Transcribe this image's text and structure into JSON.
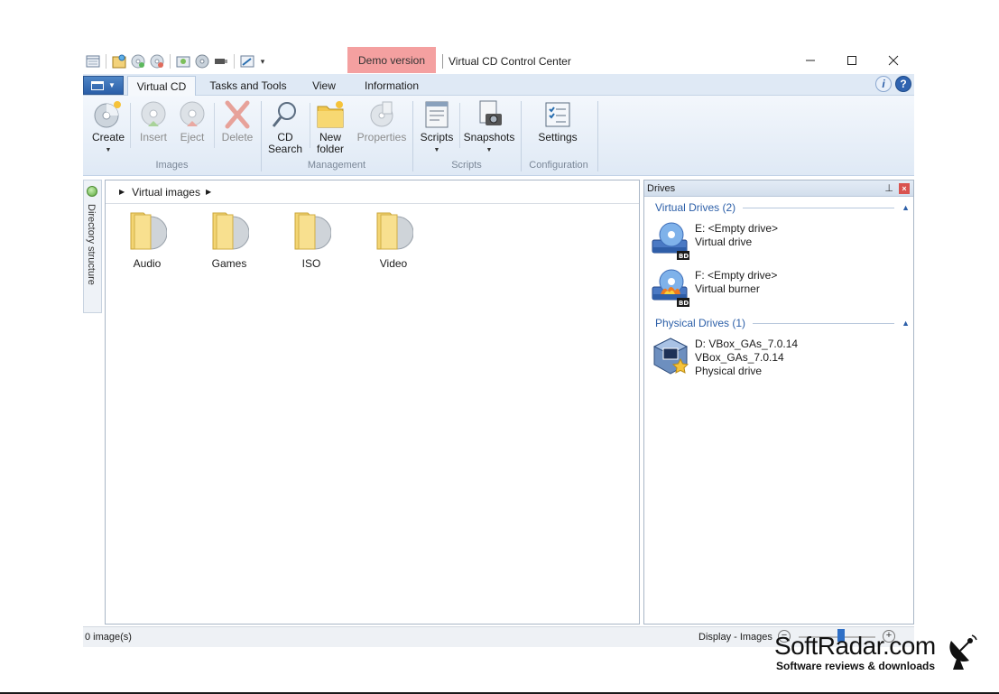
{
  "window": {
    "demo_badge": "Demo version",
    "title": "Virtual CD Control Center"
  },
  "quick_access": {
    "icons": [
      "window-icon",
      "image-icon",
      "disc-add-icon",
      "disc-eject-icon",
      "copy-disc-icon",
      "disc-icon",
      "usb-icon",
      "edit-icon"
    ],
    "more": "▾"
  },
  "tabs": [
    {
      "label": "Virtual CD",
      "active": true
    },
    {
      "label": "Tasks and Tools",
      "active": false
    },
    {
      "label": "View",
      "active": false
    },
    {
      "label": "Information",
      "active": false
    }
  ],
  "ribbon": {
    "create": "Create",
    "insert": "Insert",
    "eject": "Eject",
    "delete": "Delete",
    "cd_search_1": "CD",
    "cd_search_2": "Search",
    "new_folder_1": "New",
    "new_folder_2": "folder",
    "properties": "Properties",
    "scripts": "Scripts",
    "snapshots": "Snapshots",
    "settings": "Settings",
    "groups": {
      "images": "Images",
      "management": "Management",
      "scripts": "Scripts",
      "configuration": "Configuration"
    }
  },
  "side_strip": {
    "label": "Directory structure"
  },
  "breadcrumb": {
    "current": "Virtual images"
  },
  "folders": [
    "Audio",
    "Games",
    "ISO",
    "Video"
  ],
  "drives": {
    "header": "Drives",
    "virtual_section": "Virtual Drives (2)",
    "physical_section": "Physical Drives (1)",
    "virtual": [
      {
        "line1": "E: <Empty drive>",
        "line2": "Virtual drive"
      },
      {
        "line1": "F: <Empty drive>",
        "line2": "Virtual burner"
      }
    ],
    "physical": [
      {
        "line1": "D: VBox_GAs_7.0.14",
        "line2": "VBox_GAs_7.0.14",
        "line3": "Physical drive"
      }
    ]
  },
  "status": {
    "left": "0 image(s)",
    "right": "Display - Images",
    "zoom_level": 0.55
  },
  "watermark": {
    "brand": "SoftRadar.com",
    "tagline": "Software reviews & downloads"
  },
  "colors": {
    "accent": "#2c5fa8",
    "demo_badge": "#f4a0a0",
    "ribbon_bg": "#dfe9f5"
  }
}
